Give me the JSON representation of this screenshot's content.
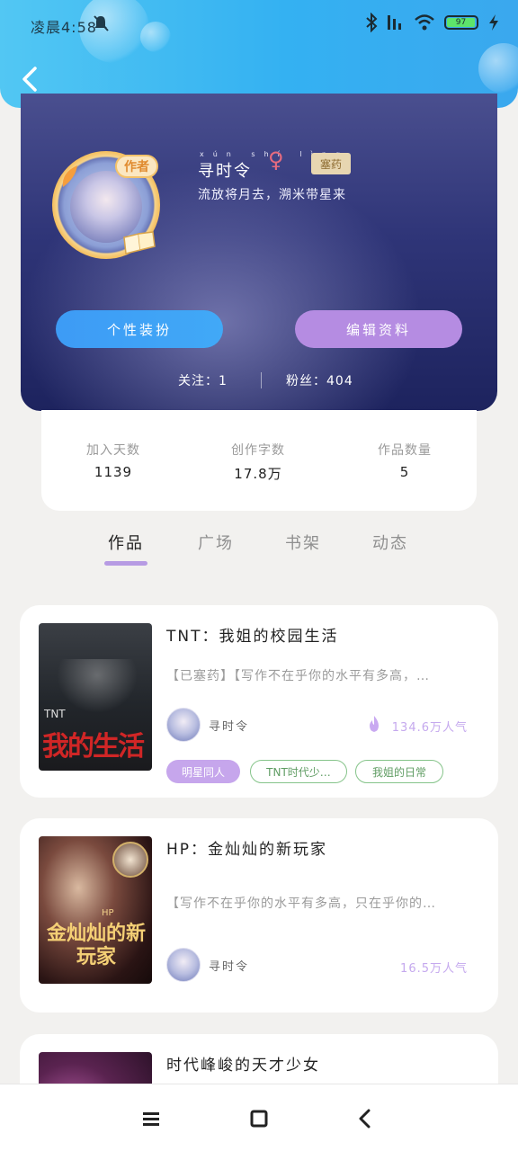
{
  "status_bar": {
    "time": "凌晨4:58",
    "battery": "97"
  },
  "profile": {
    "badge": "作者",
    "username": "寻时令",
    "username_pinyin": "xún shí lìng",
    "status_tag": "塞药",
    "bio": "流放将月去，溯米带星来",
    "decorate_button": "个性装扮",
    "edit_button": "编辑资料",
    "follow": "关注：1",
    "fans": "粉丝：404"
  },
  "stats": [
    {
      "label": "加入天数",
      "value": "1139"
    },
    {
      "label": "创作字数",
      "value": "17.8万"
    },
    {
      "label": "作品数量",
      "value": "5"
    }
  ],
  "tabs": [
    {
      "label": "作品"
    },
    {
      "label": "广场"
    },
    {
      "label": "书架"
    },
    {
      "label": "动态"
    }
  ],
  "works": [
    {
      "title": "TNT：我姐的校园生活",
      "desc": "【已塞药】【写作不在乎你的水平有多高，…",
      "author": "寻时令",
      "popularity": "134.6万人气",
      "tags": [
        "明星同人",
        "TNT时代少…",
        "我姐的日常"
      ],
      "cover_text": "我的生活",
      "cover_caption": "TNT"
    },
    {
      "title": "HP：金灿灿的新玩家",
      "desc": "【写作不在乎你的水平有多高，只在乎你的…",
      "author": "寻时令",
      "popularity": "16.5万人气",
      "tags": [],
      "cover_text": "金灿灿的新玩家",
      "cover_caption": "HP"
    },
    {
      "title": "时代峰峻的天才少女",
      "desc": "",
      "author": "",
      "popularity": "",
      "tags": []
    }
  ],
  "colors": {
    "accent_blue": "#3d9bf5",
    "accent_purple": "#b58ce2",
    "card_bg": "#ffffff"
  },
  "icons": [
    "back-icon",
    "bluetooth-icon",
    "signal-icon",
    "wifi-icon",
    "battery-icon",
    "flame-icon",
    "menu-icon",
    "home-icon"
  ]
}
